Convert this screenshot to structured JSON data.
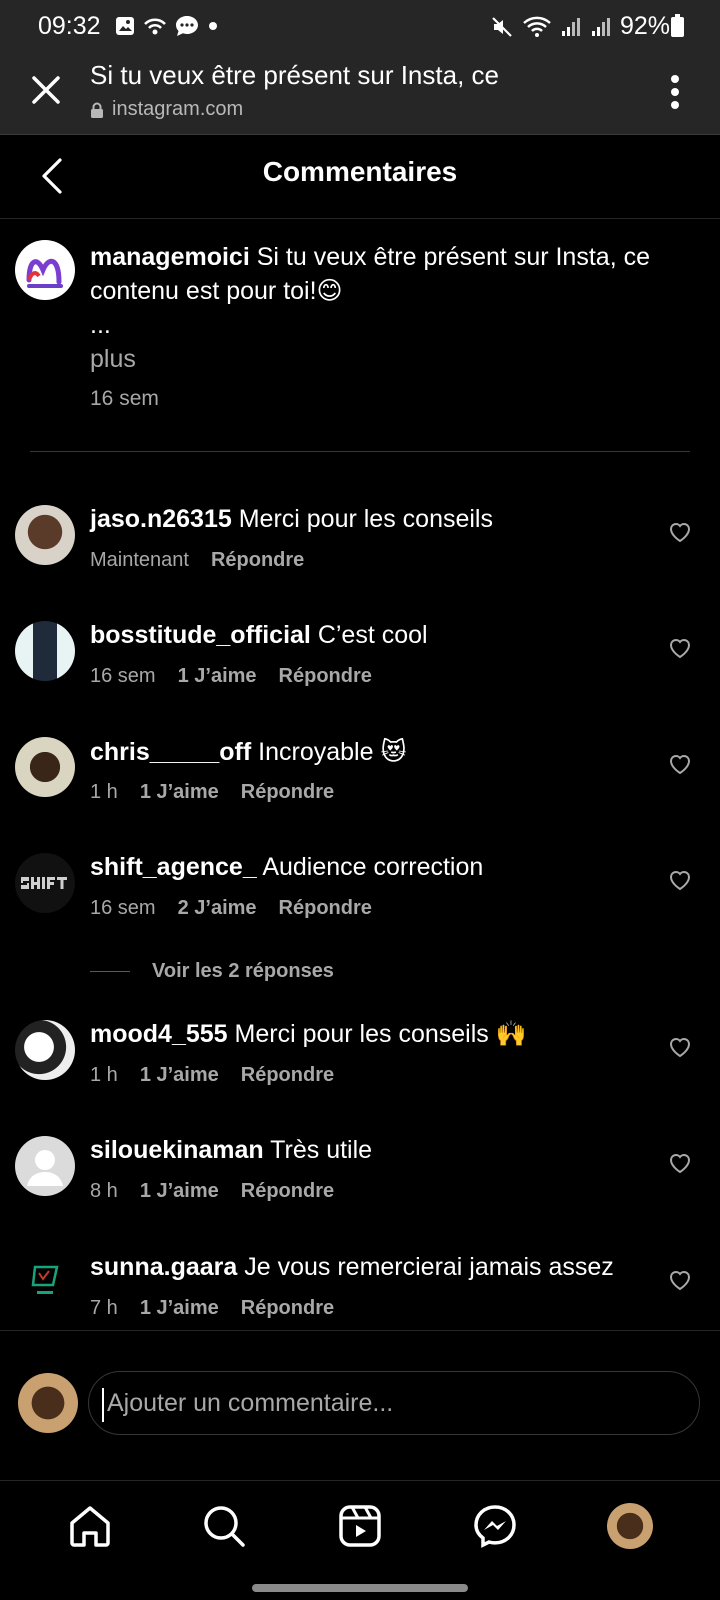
{
  "status_bar": {
    "time": "09:32",
    "battery": "92%"
  },
  "browser": {
    "title": "Si tu veux être présent sur Insta, ce",
    "url": "instagram.com"
  },
  "header": {
    "title": "Commentaires"
  },
  "caption": {
    "username": "managemoici",
    "text_line1": "Si tu veux être présent sur Insta, ce",
    "text_line2": "contenu est pour toi!😊",
    "ellipsis": "...",
    "more": "plus",
    "time": "16 sem"
  },
  "comments": [
    {
      "username": "jaso.n26315",
      "text": "Merci pour les conseils",
      "time": "Maintenant",
      "likes": "",
      "reply": "Répondre"
    },
    {
      "username": "bosstitude_official",
      "text": "C’est cool",
      "time": "16 sem",
      "likes": "1 J’aime",
      "reply": "Répondre"
    },
    {
      "username": "chris_____off",
      "text": "Incroyable 😻",
      "time": "1 h",
      "likes": "1 J’aime",
      "reply": "Répondre"
    },
    {
      "username": "shift_agence_",
      "text": "Audience correction",
      "time": "16 sem",
      "likes": "2 J’aime",
      "reply": "Répondre"
    },
    {
      "username": "mood4_555",
      "text": "Merci pour les conseils 🙌",
      "time": "1 h",
      "likes": "1 J’aime",
      "reply": "Répondre"
    },
    {
      "username": "silouekinaman",
      "text": "Très utile",
      "time": "8 h",
      "likes": "1 J’aime",
      "reply": "Répondre"
    },
    {
      "username": "sunna.gaara",
      "text": "Je vous remercierai jamais assez",
      "time": "7 h",
      "likes": "1 J’aime",
      "reply": "Répondre"
    }
  ],
  "view_replies": "Voir les 2 réponses",
  "input": {
    "placeholder": "Ajouter un commentaire..."
  },
  "nav": [
    "home-icon",
    "search-icon",
    "reels-icon",
    "messenger-icon",
    "profile-avatar"
  ],
  "colors": {
    "background": "#000000",
    "muted": "#a8a8a8",
    "browser_bar": "#262626"
  }
}
